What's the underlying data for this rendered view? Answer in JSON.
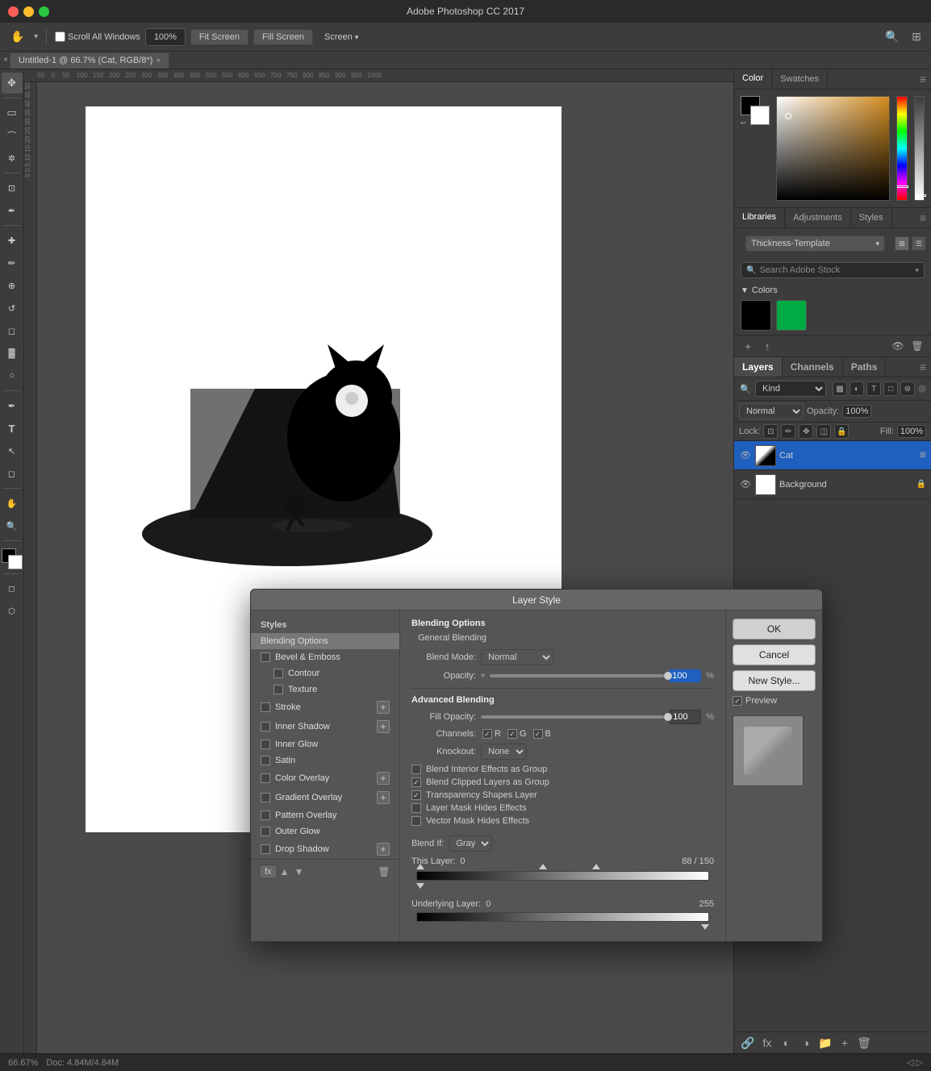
{
  "app": {
    "title": "Adobe Photoshop CC 2017",
    "window_controls": {
      "close": "close",
      "minimize": "minimize",
      "maximize": "maximize"
    }
  },
  "toolbar": {
    "scroll_all_windows": "Scroll All Windows",
    "zoom_level": "100%",
    "fit_screen": "Fit Screen",
    "fill_screen": "Fill Screen",
    "screen_mode": "Screen"
  },
  "doc_tab": {
    "name": "Untitled-1 @ 66.7% (Cat, RGB/8*)",
    "close": "×"
  },
  "color_panel": {
    "tabs": [
      "Color",
      "Swatches"
    ],
    "active_tab": "Color"
  },
  "libraries_panel": {
    "tabs": [
      "Libraries",
      "Adjustments",
      "Styles"
    ],
    "active_tab": "Libraries",
    "dropdown_value": "Thickness-Template",
    "search_placeholder": "Search Adobe Stock",
    "colors_section_label": "Colors",
    "color_chips": [
      {
        "color": "#000000"
      },
      {
        "color": "#00aa44"
      }
    ]
  },
  "layers_panel": {
    "tabs": [
      "Layers",
      "Channels",
      "Paths"
    ],
    "active_tab": "Layers",
    "blend_mode": "Normal",
    "opacity_label": "Opacity:",
    "opacity_value": "100%",
    "lock_label": "Lock:",
    "fill_label": "Fill:",
    "fill_value": "100%",
    "layers": [
      {
        "name": "Cat",
        "visible": true,
        "selected": true,
        "locked": false,
        "has_effects": true
      },
      {
        "name": "Background",
        "visible": true,
        "selected": false,
        "locked": true
      }
    ]
  },
  "status_bar": {
    "zoom": "66.67%",
    "doc_info": "Doc: 4.84M/4.84M"
  },
  "dialog": {
    "title": "Layer Style",
    "styles_header": "Styles",
    "style_items": [
      {
        "label": "Blending Options",
        "checked": false,
        "active": true,
        "has_add": false
      },
      {
        "label": "Bevel & Emboss",
        "checked": false,
        "active": false,
        "has_add": false
      },
      {
        "label": "Contour",
        "checked": false,
        "active": false,
        "has_add": false
      },
      {
        "label": "Texture",
        "checked": false,
        "active": false,
        "has_add": false
      },
      {
        "label": "Stroke",
        "checked": false,
        "active": false,
        "has_add": true
      },
      {
        "label": "Inner Shadow",
        "checked": false,
        "active": false,
        "has_add": true
      },
      {
        "label": "Inner Glow",
        "checked": false,
        "active": false,
        "has_add": false
      },
      {
        "label": "Satin",
        "checked": false,
        "active": false,
        "has_add": false
      },
      {
        "label": "Color Overlay",
        "checked": false,
        "active": false,
        "has_add": true
      },
      {
        "label": "Gradient Overlay",
        "checked": false,
        "active": false,
        "has_add": true
      },
      {
        "label": "Pattern Overlay",
        "checked": false,
        "active": false,
        "has_add": false
      },
      {
        "label": "Outer Glow",
        "checked": false,
        "active": false,
        "has_add": false
      },
      {
        "label": "Drop Shadow",
        "checked": false,
        "active": false,
        "has_add": true
      }
    ],
    "ok_btn": "OK",
    "cancel_btn": "Cancel",
    "new_style_btn": "New Style...",
    "preview_label": "Preview",
    "preview_checked": true,
    "blending_options": {
      "section_title": "Blending Options",
      "general_blending": "General Blending",
      "blend_mode_label": "Blend Mode:",
      "blend_mode_value": "Normal",
      "opacity_label": "Opacity:",
      "opacity_value": "100",
      "opacity_unit": "%",
      "advanced_blending": "Advanced Blending",
      "fill_opacity_label": "Fill Opacity:",
      "fill_opacity_value": "100",
      "fill_opacity_unit": "%",
      "channels_label": "Channels:",
      "channels": [
        "R",
        "G",
        "B"
      ],
      "knockout_label": "Knockout:",
      "knockout_value": "None",
      "checkboxes": [
        {
          "label": "Blend Interior Effects as Group",
          "checked": false
        },
        {
          "label": "Blend Clipped Layers as Group",
          "checked": true
        },
        {
          "label": "Transparency Shapes Layer",
          "checked": true
        },
        {
          "label": "Layer Mask Hides Effects",
          "checked": false
        },
        {
          "label": "Vector Mask Hides Effects",
          "checked": false
        }
      ],
      "blend_if_label": "Blend If:",
      "blend_if_value": "Gray",
      "this_layer_label": "This Layer:",
      "this_layer_start": "0",
      "this_layer_mid1": "88",
      "this_layer_sep": "/",
      "this_layer_mid2": "150",
      "underlying_layer_label": "Underlying Layer:",
      "underlying_start": "0",
      "underlying_end": "255"
    },
    "footer": {
      "fx_label": "fx",
      "move_up": "▲",
      "move_down": "▼",
      "delete": "🗑"
    }
  },
  "tools": [
    {
      "name": "move",
      "icon": "✥"
    },
    {
      "name": "select-rect",
      "icon": "▭"
    },
    {
      "name": "lasso",
      "icon": "⌒"
    },
    {
      "name": "magic-wand",
      "icon": "✲"
    },
    {
      "name": "crop",
      "icon": "⊡"
    },
    {
      "name": "eyedropper",
      "icon": "✒"
    },
    {
      "name": "healing",
      "icon": "✚"
    },
    {
      "name": "brush",
      "icon": "✏"
    },
    {
      "name": "stamp",
      "icon": "⊕"
    },
    {
      "name": "history",
      "icon": "↺"
    },
    {
      "name": "eraser",
      "icon": "◻"
    },
    {
      "name": "gradient",
      "icon": "▓"
    },
    {
      "name": "dodge",
      "icon": "○"
    },
    {
      "name": "pen",
      "icon": "✒"
    },
    {
      "name": "text",
      "icon": "T"
    },
    {
      "name": "path-select",
      "icon": "↖"
    },
    {
      "name": "shape",
      "icon": "◻"
    },
    {
      "name": "hand",
      "icon": "✋"
    },
    {
      "name": "zoom",
      "icon": "🔍"
    },
    {
      "name": "3d",
      "icon": "⬡"
    }
  ]
}
